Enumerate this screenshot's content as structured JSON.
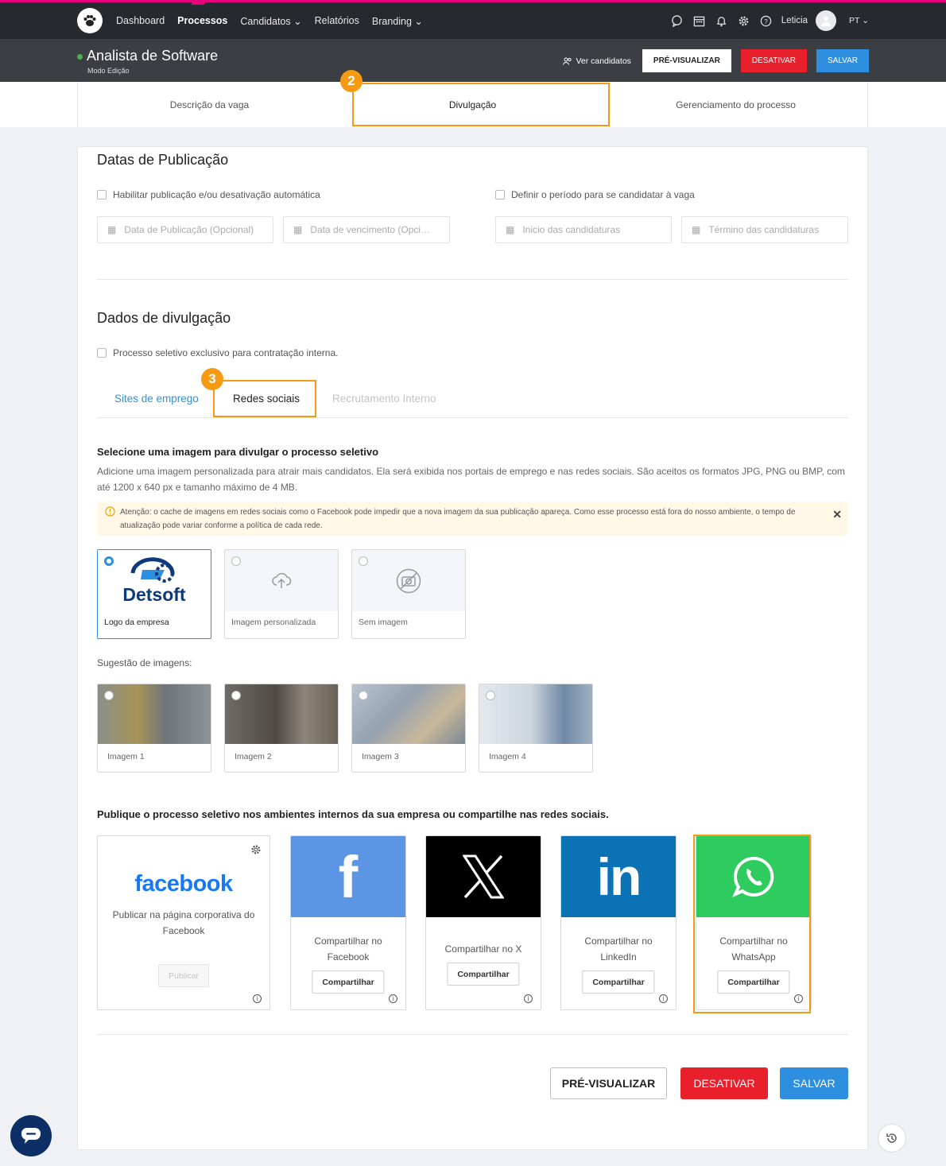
{
  "topnav": {
    "items": [
      "Dashboard",
      "Processos",
      "Candidatos",
      "Relatórios",
      "Branding"
    ],
    "active": "Processos",
    "user": "Leticia",
    "lang": "PT"
  },
  "header": {
    "title": "Analista de Software",
    "mode": "Modo Edição",
    "ver_candidatos": "Ver candidatos",
    "preview": "PRÉ-VISUALIZAR",
    "deactivate": "DESATIVAR",
    "save": "SALVAR"
  },
  "tabs": [
    "Descrição da vaga",
    "Divulgação",
    "Gerenciamento do processo"
  ],
  "badges": {
    "step2": "2",
    "step3": "3"
  },
  "datas": {
    "title": "Datas de Publicação",
    "check1": "Habilitar publicação e/ou desativação automática",
    "check2": "Definir o período para se candidatar à vaga",
    "input1": "Data de Publicação (Opcional)",
    "input2": "Data de vencimento (Opci…",
    "input3": "Inicio das candidaturas",
    "input4": "Término das candidaturas"
  },
  "divulgacao": {
    "title": "Dados de divulgação",
    "check": "Processo seletivo exclusivo para contratação interna.",
    "subtabs": [
      "Sites de emprego",
      "Redes sociais",
      "Recrutamento Interno"
    ]
  },
  "image_section": {
    "title": "Selecione uma imagem para divulgar o processo seletivo",
    "desc": "Adicione uma imagem personalizada para atrair mais candidatos. Ela será exibida nos portais de emprego e nas redes sociais. São aceitos os formatos JPG, PNG ou BMP, com até 1200 x 640 px e tamanho máximo de 4 MB.",
    "alert": "Atenção: o cache de imagens em redes sociais como o Facebook pode impedir que a nova imagem da sua publicação apareça. Como esse processo está fora do nosso ambiente, o tempo de atualização pode variar conforme a política de cada rede.",
    "options": [
      "Logo da empresa",
      "Imagem personalizada",
      "Sem imagem"
    ],
    "logo_text": "Detsoft",
    "suggest_label": "Sugestão de imagens:",
    "suggestions": [
      "Imagem 1",
      "Imagem 2",
      "Imagem 3",
      "Imagem 4"
    ]
  },
  "share_section": {
    "title": "Publique o processo seletivo nos ambientes internos da sua empresa ou compartilhe nas redes sociais.",
    "fb_brand": "facebook",
    "fb_desc": "Publicar na página corporativa do Facebook",
    "fb_btn": "Publicar",
    "facebook": "Compartilhar no Facebook",
    "x": "Compartilhar no X",
    "linkedin": "Compartilhar no LinkedIn",
    "whatsapp": "Compartilhar no WhatsApp",
    "btn": "Compartilhar",
    "colors": {
      "facebook": "#5b95e3",
      "x": "#000000",
      "linkedin": "#0a72b5",
      "whatsapp": "#2ecb5f"
    }
  },
  "footer": {
    "preview": "PRÉ-VISUALIZAR",
    "deactivate": "DESATIVAR",
    "save": "SALVAR"
  }
}
